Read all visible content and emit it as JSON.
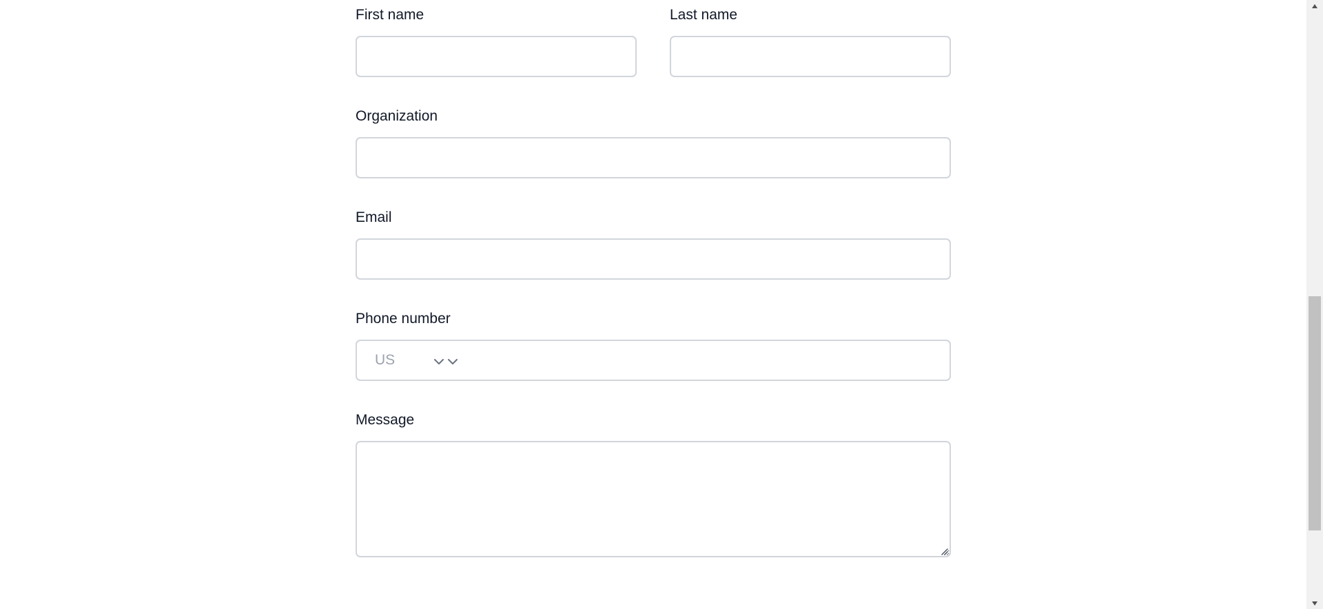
{
  "form": {
    "first_name": {
      "label": "First name",
      "value": ""
    },
    "last_name": {
      "label": "Last name",
      "value": ""
    },
    "organization": {
      "label": "Organization",
      "value": ""
    },
    "email": {
      "label": "Email",
      "value": ""
    },
    "phone": {
      "label": "Phone number",
      "country": "US",
      "value": ""
    },
    "message": {
      "label": "Message",
      "value": ""
    }
  },
  "icons": {
    "country_dropdown": "chevron-down-icon",
    "scroll_up": "triangle-up-icon",
    "scroll_down": "triangle-down-icon",
    "resize": "resize-grip-icon"
  },
  "colors": {
    "input_border": "#d1d5db",
    "label_text": "#111827",
    "placeholder_text": "#9ca3af",
    "scrollbar_track": "#f1f1f1",
    "scrollbar_thumb": "#c1c1c1"
  }
}
